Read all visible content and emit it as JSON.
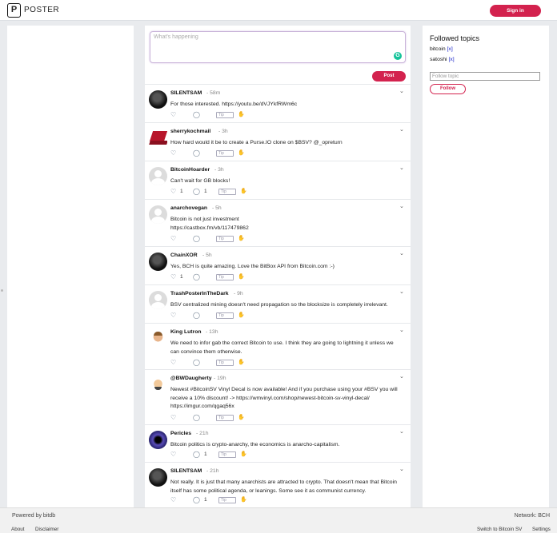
{
  "header": {
    "logo_letter": "P",
    "app_title": "POSTER",
    "signin_label": "Sign in"
  },
  "composer": {
    "placeholder": "What's happening",
    "post_label": "Post"
  },
  "posts": [
    {
      "author": "SILENTSAM",
      "time": "- 58m",
      "text": "For those interested.  https://youtu.be/dVJYkfRWm6c",
      "likes": "",
      "replies": "",
      "tip": "Tip"
    },
    {
      "author": "sherrykochmail",
      "time": "- 3h",
      "text": "How hard would it be to create a Purse.IO clone on $BSV? @_opreturn",
      "likes": "",
      "replies": "",
      "tip": "Tip"
    },
    {
      "author": "BitcoinHoarder",
      "time": "- 3h",
      "text": "Can't wait for GB blocks!",
      "likes": "1",
      "replies": "1",
      "tip": "Tip"
    },
    {
      "author": "anarchovegan",
      "time": "- 5h",
      "text": "Bitcoin is not just investment https://castbox.fm/vb/117479862",
      "likes": "",
      "replies": "",
      "tip": "Tip"
    },
    {
      "author": "ChainXOR",
      "time": "- 5h",
      "text": "Yes, BCH is quite amazing. Love the BitBox API from Bitcoin.com :-)",
      "likes": "1",
      "replies": "",
      "tip": "Tip"
    },
    {
      "author": "TrashPosterInTheDark",
      "time": "- 9h",
      "text": "BSV centralized  mining doesn't need propagation so the blocksize is completely irrelevant.",
      "likes": "",
      "replies": "",
      "tip": "Tip"
    },
    {
      "author": "King Lutron",
      "time": "- 13h",
      "text": "We need to infor gab the correct Bitcoin to use. I think they are going to lightning it unless we can convince them otherwise.",
      "likes": "",
      "replies": "",
      "tip": "Tip"
    },
    {
      "author": "@BWDaugherty",
      "time": "- 19h",
      "text": "Newest #BitcoinSV Vinyl Decal is now available! And if you purchase using your #BSV you will receive a 10% discount! -> https://wmvinyl.com/shop/newest-bitcoin-sv-vinyl-decal/ https://imgur.com/qgaq56x",
      "likes": "",
      "replies": "",
      "tip": "Tip"
    },
    {
      "author": "Pericles",
      "time": "- 21h",
      "text": "Bitcoin politics is crypto-anarchy, the economics is anarcho-capitalism.",
      "likes": "",
      "replies": "1",
      "tip": "Tip"
    },
    {
      "author": "SILENTSAM",
      "time": "- 21h",
      "text": "Not really. It is just that many anarchists are attracted to crypto. That doesn't mean that Bitcoin itself has some political agenda, or leanings. Some see it as communist currency.",
      "likes": "",
      "replies": "1",
      "tip": "Tip"
    }
  ],
  "sidebar": {
    "title": "Followed topics",
    "topics": [
      {
        "name": "bitcoin",
        "remove": "[x]"
      },
      {
        "name": "satoshi",
        "remove": "[x]"
      }
    ],
    "input_placeholder": "Follow topic",
    "follow_label": "Follow"
  },
  "footer": {
    "powered": "Powered by bitdb",
    "network": "Network: BCH",
    "about": "About",
    "disclaimer": "Disclaimer",
    "switch": "Switch to Bitcoin SV",
    "settings": "Settings"
  },
  "icons": {
    "heart": "heart-icon",
    "reply": "reply-icon",
    "tip_hand": "tip-hand-icon",
    "chevron": "chevron-down-icon"
  },
  "colors": {
    "accent": "#d3224e",
    "link": "#1a25c9",
    "background": "#e9ebee"
  }
}
